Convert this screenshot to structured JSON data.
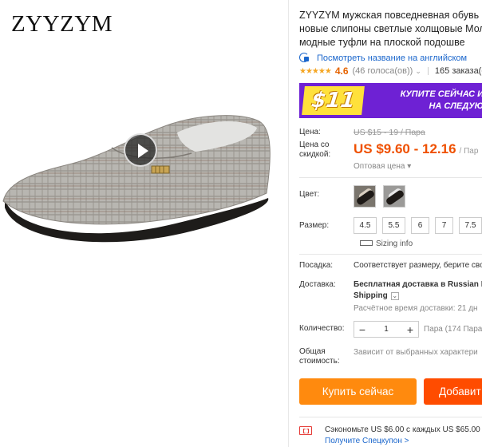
{
  "brand_logo": "ZYYZYM",
  "product": {
    "title_lines": [
      "ZYYZYM мужская повседневная обувь 20",
      "новые слипоны светлые холщовые Мол",
      "модные туфли на плоской подошве"
    ],
    "translate_link": "Посмотреть название на английском",
    "rating": {
      "stars": "★★★★★",
      "value": "4.6",
      "votes": "(46 голоса(ов))",
      "orders": "165 заказа(о"
    },
    "promo": {
      "price": "$11",
      "line1": "КУПИТЕ СЕЙЧАС И П",
      "line2": "НА СЛЕДУЮЩ"
    },
    "price": {
      "label": "Цена:",
      "old": "US $15 - 19 / Пара",
      "discount_label": "Цена со скидкой:",
      "new": "US $9.60 - 12.16",
      "unit": "/ Пар",
      "wholesale": "Оптовая цена ▾"
    },
    "color": {
      "label": "Цвет:"
    },
    "size": {
      "label": "Размер:",
      "options": [
        "4.5",
        "5.5",
        "6",
        "7",
        "7.5"
      ],
      "sizing_info": "Sizing info"
    },
    "fit": {
      "label": "Посадка:",
      "value": "Соответствует размеру, берите сво"
    },
    "shipping": {
      "label": "Доставка:",
      "line1": "Бесплатная доставка в Russian F",
      "line2": "Shipping",
      "eta": "Расчётное время доставки: 21 дн"
    },
    "quantity": {
      "label": "Количество:",
      "minus": "−",
      "value": "1",
      "plus": "+",
      "available": "Пара (174 Пара"
    },
    "total": {
      "label": "Общая стоимость:",
      "value": "Зависит от выбранных характери"
    },
    "buttons": {
      "buy": "Купить сейчас",
      "cart": "Добавит"
    },
    "coupon": {
      "text": "Сэкономьте US $6.00 с каждых US $65.00",
      "link": "Получите Спецкупон >"
    }
  }
}
